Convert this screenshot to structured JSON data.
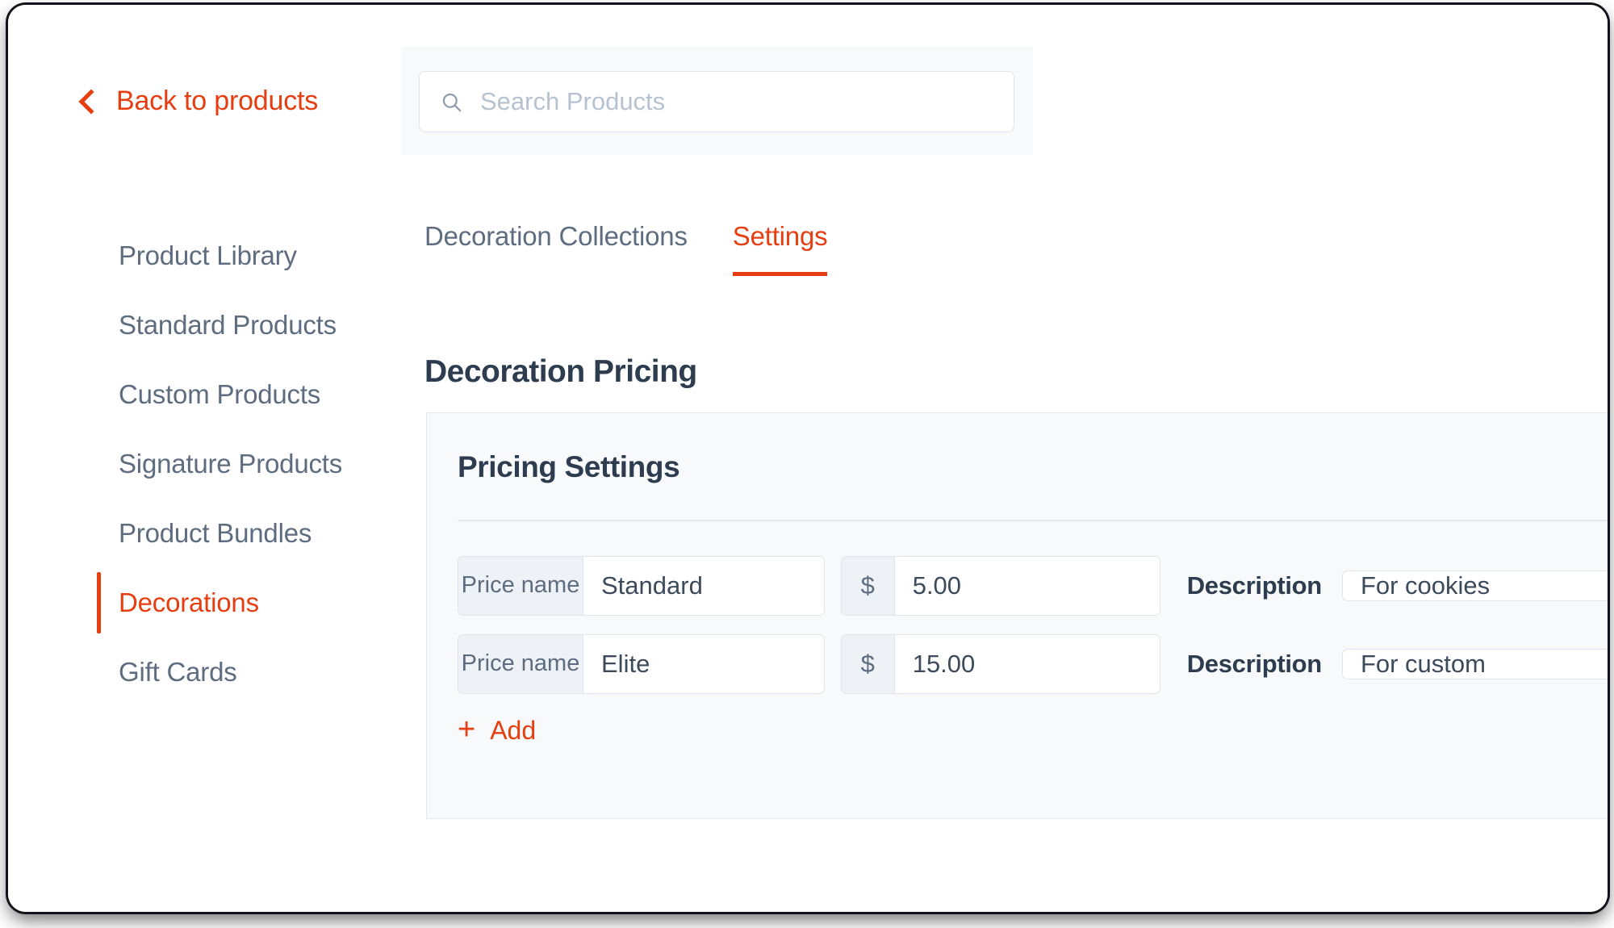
{
  "theme": {
    "accent": "#E63E11",
    "text_primary": "#2D3C4E",
    "text_muted": "#5E6C80",
    "card_bg": "#F7F9FB",
    "border": "#DFE5ED"
  },
  "header": {
    "back_label": "Back to products",
    "back_icon": "chevron-left-icon",
    "search": {
      "icon": "search-icon",
      "placeholder": "Search Products",
      "value": ""
    }
  },
  "sidebar": {
    "items": [
      {
        "label": "Product Library",
        "active": false
      },
      {
        "label": "Standard Products",
        "active": false
      },
      {
        "label": "Custom Products",
        "active": false
      },
      {
        "label": "Signature Products",
        "active": false
      },
      {
        "label": "Product Bundles",
        "active": false
      },
      {
        "label": "Decorations",
        "active": true
      },
      {
        "label": "Gift Cards",
        "active": false
      }
    ]
  },
  "tabs": [
    {
      "label": "Decoration Collections",
      "active": false
    },
    {
      "label": "Settings",
      "active": true
    }
  ],
  "main": {
    "page_title": "Decoration Pricing",
    "card": {
      "title": "Pricing Settings",
      "name_affix": "Price name",
      "money_affix": "$",
      "description_label": "Description",
      "rows": [
        {
          "name": "Standard",
          "price": "5.00",
          "description": "For cookies"
        },
        {
          "name": "Elite",
          "price": "15.00",
          "description": "For custom"
        }
      ],
      "add_label": "Add",
      "add_icon": "plus-icon"
    }
  }
}
